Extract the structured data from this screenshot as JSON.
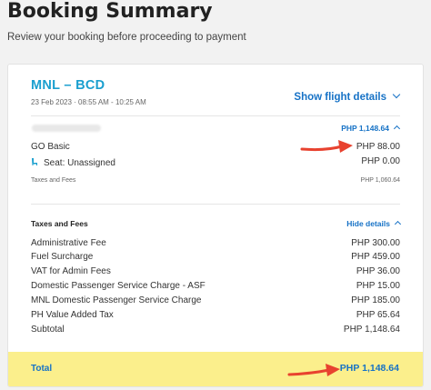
{
  "header": {
    "title": "Booking Summary",
    "subtitle": "Review your booking before proceeding to payment"
  },
  "flight": {
    "route": "MNL – BCD",
    "datetime": "23 Feb 2023 · 08:55 AM - 10:25 AM",
    "show_details": "Show flight details"
  },
  "fare": {
    "total": "PHP 1,148.64",
    "items": [
      {
        "label": "GO Basic",
        "value": "PHP 88.00"
      },
      {
        "label": "Seat: Unassigned",
        "value": "PHP 0.00",
        "icon": "seat-icon"
      },
      {
        "label": "Taxes and Fees",
        "value": "PHP 1,060.64"
      }
    ]
  },
  "taxes": {
    "heading": "Taxes and Fees",
    "toggle": "Hide details",
    "items": [
      {
        "label": "Administrative Fee",
        "value": "PHP 300.00"
      },
      {
        "label": "Fuel Surcharge",
        "value": "PHP 459.00"
      },
      {
        "label": "VAT for Admin Fees",
        "value": "PHP 36.00"
      },
      {
        "label": "Domestic Passenger Service Charge - ASF",
        "value": "PHP 15.00"
      },
      {
        "label": "MNL Domestic Passenger Service Charge",
        "value": "PHP 185.00"
      },
      {
        "label": "PH Value Added Tax",
        "value": "PHP 65.64"
      },
      {
        "label": "Subtotal",
        "value": "PHP 1,148.64"
      }
    ]
  },
  "total": {
    "label": "Total",
    "value": "PHP 1,148.64"
  },
  "colors": {
    "accent": "#1672c6",
    "route": "#1a9fcf",
    "total_bar": "#fbef8c",
    "annotation_arrow": "#e8422f"
  }
}
